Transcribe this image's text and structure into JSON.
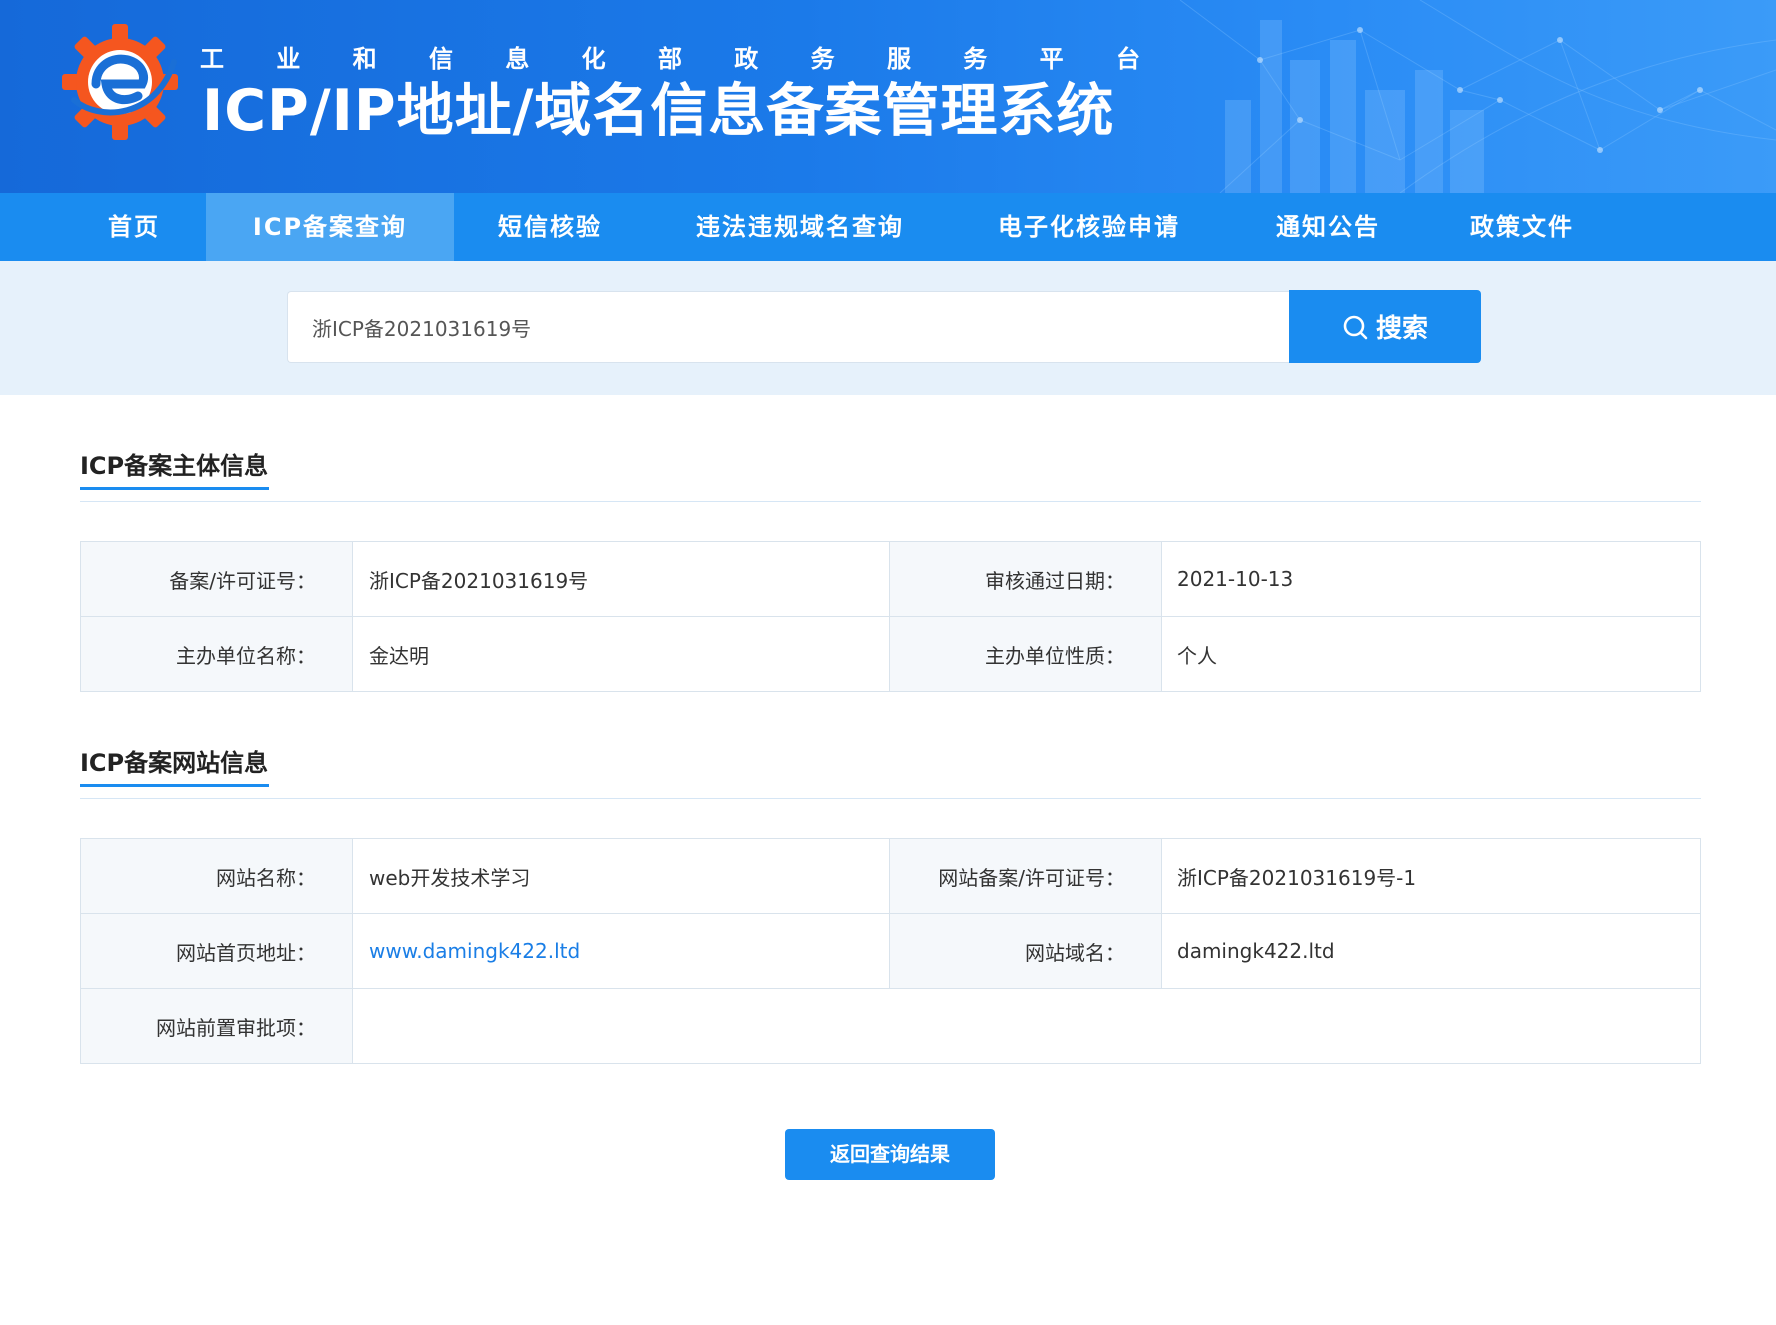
{
  "header": {
    "subtitle_chars": [
      "工",
      "业",
      "和",
      "信",
      "息",
      "化",
      "部",
      "政",
      "务",
      "服",
      "务",
      "平",
      "台"
    ],
    "title": "ICP/IP地址/域名信息备案管理系统",
    "logo_icon": "miit-gear-logo-icon"
  },
  "nav": {
    "items": [
      {
        "label": "首页"
      },
      {
        "label": "ICP备案查询",
        "active": true
      },
      {
        "label": "短信核验"
      },
      {
        "label": "违法违规域名查询"
      },
      {
        "label": "电子化核验申请"
      },
      {
        "label": "通知公告"
      },
      {
        "label": "政策文件"
      }
    ]
  },
  "search": {
    "value": "浙ICP备2021031619号",
    "button_label": "搜索",
    "button_icon": "search-icon"
  },
  "entity": {
    "section_title": "ICP备案主体信息",
    "license_label": "备案/许可证号：",
    "license_value": "浙ICP备2021031619号",
    "approval_date_label": "审核通过日期：",
    "approval_date_value": "2021-10-13",
    "org_name_label": "主办单位名称：",
    "org_name_value": "金达明",
    "org_type_label": "主办单位性质：",
    "org_type_value": "个人"
  },
  "website": {
    "section_title": "ICP备案网站信息",
    "site_name_label": "网站名称：",
    "site_name_value": "web开发技术学习",
    "site_license_label": "网站备案/许可证号：",
    "site_license_value": "浙ICP备2021031619号-1",
    "homepage_label": "网站首页地址：",
    "homepage_value": "www.damingk422.ltd",
    "domain_label": "网站域名：",
    "domain_value": "damingk422.ltd",
    "pre_approval_label": "网站前置审批项：",
    "pre_approval_value": ""
  },
  "actions": {
    "back_label": "返回查询结果"
  },
  "colors": {
    "primary": "#1a8cf0",
    "nav_active": "#4aa6f3",
    "search_strip": "#e6f1fb",
    "link": "#1a7ee6"
  }
}
